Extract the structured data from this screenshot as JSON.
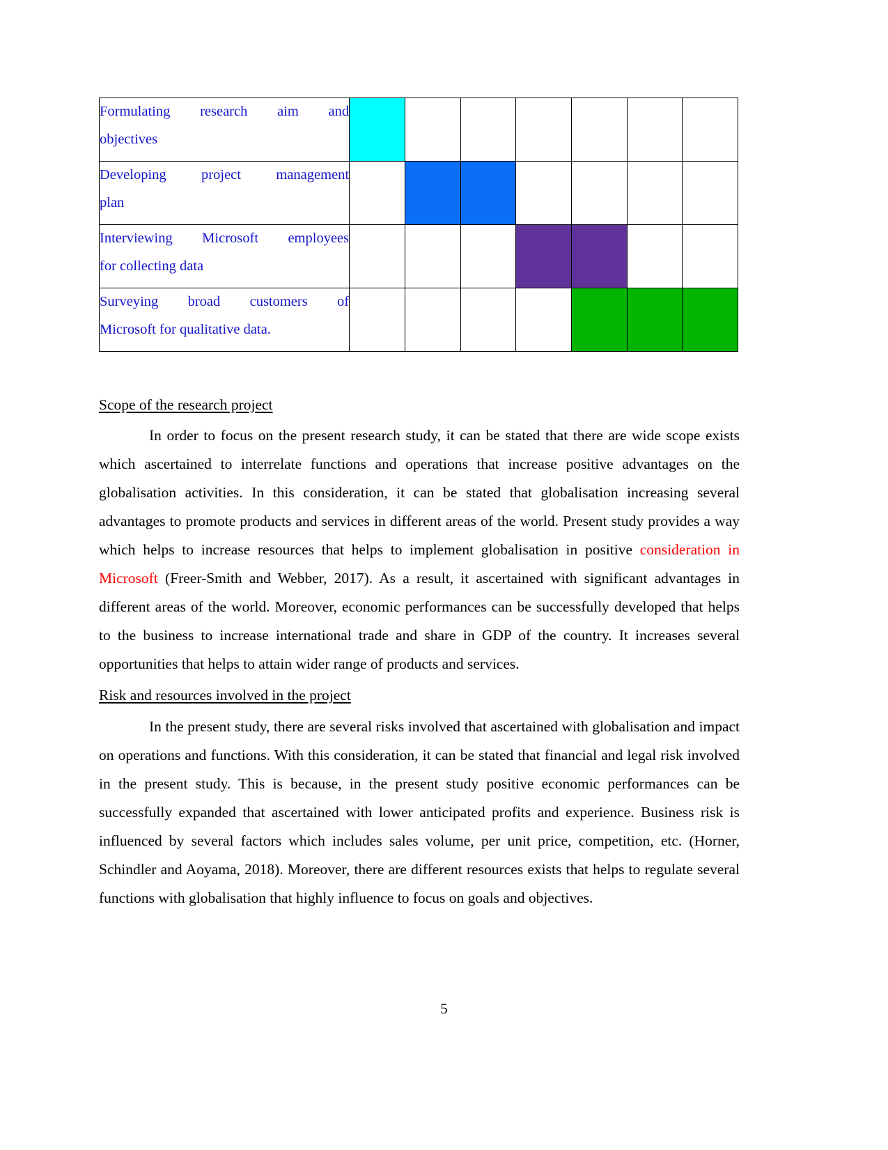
{
  "document": {
    "page_number": "5",
    "colors": {
      "task_text": "#1414c8",
      "highlight_red": "#ff0000",
      "bar_cyan": "#00ffff",
      "bar_blue": "#0a6ff5",
      "bar_purple": "#5f3299",
      "bar_green": "#00b400"
    }
  },
  "gantt": {
    "columns": 7,
    "rows": [
      {
        "task_lines": [
          "Formulating research aim and",
          "objectives"
        ],
        "bars": [
          {
            "column": 1,
            "color": "#00ffff",
            "name": "bar-cyan"
          }
        ]
      },
      {
        "task_lines": [
          "Developing project management",
          "plan"
        ],
        "bars": [
          {
            "column": 2,
            "color": "#0a6ff5",
            "name": "bar-blue"
          },
          {
            "column": 3,
            "color": "#0a6ff5",
            "name": "bar-blue"
          }
        ]
      },
      {
        "task_lines": [
          "Interviewing Microsoft employees",
          "for collecting data"
        ],
        "bars": [
          {
            "column": 4,
            "color": "#5f3299",
            "name": "bar-purple"
          },
          {
            "column": 5,
            "color": "#5f3299",
            "name": "bar-purple"
          }
        ]
      },
      {
        "task_lines": [
          "Surveying broad customers of",
          "Microsoft for qualitative data."
        ],
        "bars": [
          {
            "column": 5,
            "color": "#00b400",
            "name": "bar-green"
          },
          {
            "column": 6,
            "color": "#00b400",
            "name": "bar-green"
          },
          {
            "column": 7,
            "color": "#00b400",
            "name": "bar-green"
          }
        ]
      }
    ]
  },
  "sections": [
    {
      "heading": "Scope of the research project",
      "paragraph": {
        "part1": "In order to focus on the present research study, it can be stated that there are wide scope exists which ascertained to interrelate functions and operations that increase positive advantages on the globalisation activities. In this consideration, it can be stated that globalisation increasing several advantages to promote products and services in different areas of the world. Present study provides a way which helps to increase resources that helps to implement globalisation in positive ",
        "highlight": "consideration in Microsoft",
        "part2": " (Freer-Smith and Webber, 2017). As a result, it ascertained with significant advantages in different areas of the world. Moreover, economic performances can be successfully developed that helps to the business to increase international trade and share in GDP of the country. It increases several opportunities that helps to attain wider range of products and services."
      }
    },
    {
      "heading": "Risk and resources involved in the project",
      "paragraph": {
        "part1": "In the present study, there are several risks involved that ascertained with globalisation and impact on operations and functions. With this consideration, it can be stated that financial and legal risk involved in the present study. This is because, in the present study positive economic performances can be successfully expanded that ascertained with lower anticipated profits and experience. Business risk is influenced by several factors which includes sales volume, per unit price, competition, etc. (Horner, Schindler and Aoyama, 2018). Moreover, there are different resources exists that helps to regulate several functions with globalisation that highly influence to focus on goals and objectives.",
        "highlight": "",
        "part2": ""
      }
    }
  ]
}
